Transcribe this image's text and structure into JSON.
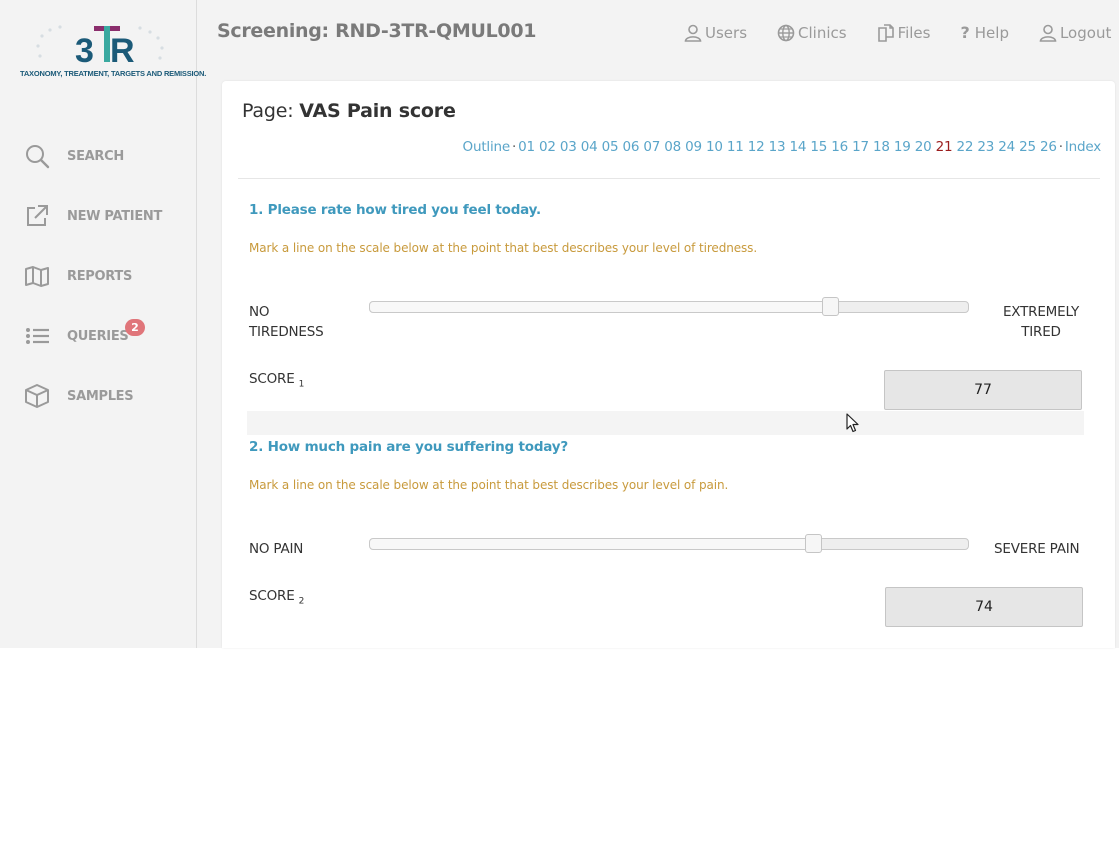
{
  "logo": {
    "text": "3TR",
    "tagline": "TAXONOMY, TREATMENT, TARGETS AND REMISSION."
  },
  "sidebar": {
    "items": [
      {
        "label": "SEARCH",
        "icon": "search-icon"
      },
      {
        "label": "NEW PATIENT",
        "icon": "external-link-icon"
      },
      {
        "label": "REPORTS",
        "icon": "map-icon"
      },
      {
        "label": "QUERIES",
        "icon": "list-icon",
        "badge": "2"
      },
      {
        "label": "SAMPLES",
        "icon": "box-icon"
      }
    ]
  },
  "header": {
    "title": "Screening: RND-3TR-QMUL001"
  },
  "topnav": {
    "users": "Users",
    "clinics": "Clinics",
    "files": "Files",
    "help": "Help",
    "logout": "Logout"
  },
  "page": {
    "prefix": "Page:",
    "name": "VAS Pain score",
    "pager": {
      "outline": "Outline",
      "index": "Index",
      "pages": [
        "01",
        "02",
        "03",
        "04",
        "05",
        "06",
        "07",
        "08",
        "09",
        "10",
        "11",
        "12",
        "13",
        "14",
        "15",
        "16",
        "17",
        "18",
        "19",
        "20",
        "21",
        "22",
        "23",
        "24",
        "25",
        "26"
      ],
      "current": "21"
    }
  },
  "questions": [
    {
      "title": "1. Please rate how tired you feel today.",
      "instruction": "Mark a line on the scale below at the point that best describes your level of tiredness.",
      "min_label_line1": "NO",
      "min_label_line2": "TIREDNESS",
      "max_label_line1": "EXTREMELY",
      "max_label_line2": "TIRED",
      "slider_value": 77,
      "score_label": "SCORE",
      "score_sub": "1",
      "score_value": "77"
    },
    {
      "title": "2. How much pain are you suffering today?",
      "instruction": "Mark a line on the scale below at the point that best describes your level of pain.",
      "min_label": "NO PAIN",
      "max_label": "SEVERE PAIN",
      "slider_value": 74,
      "score_label": "SCORE",
      "score_sub": "2",
      "score_value": "74"
    }
  ],
  "colors": {
    "accent": "#3f99bd",
    "instruction": "#c89a3c",
    "current_page": "#9b1d1d",
    "badge": "#e0757a",
    "nav_text": "#9a9a9a"
  }
}
